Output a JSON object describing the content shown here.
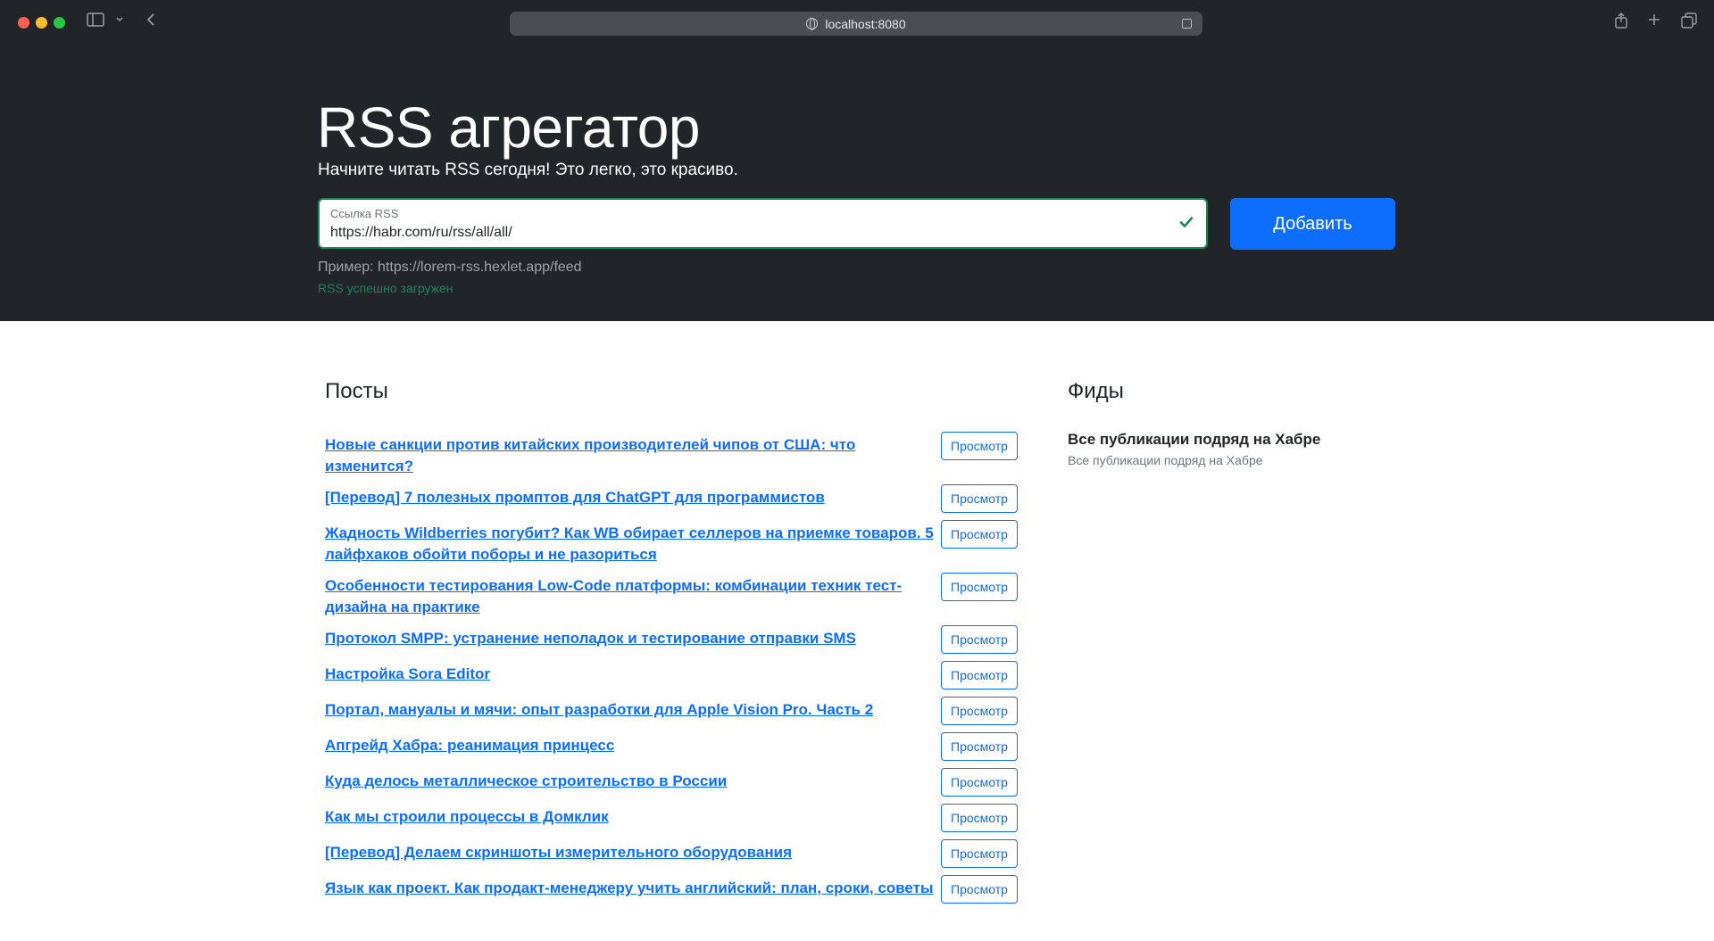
{
  "browser": {
    "url": "localhost:8080"
  },
  "hero": {
    "title": "RSS агрегатор",
    "lead": "Начните читать RSS сегодня! Это легко, это красиво.",
    "input_label": "Ссылка RSS",
    "input_value": "https://habr.com/ru/rss/all/all/",
    "add_button": "Добавить",
    "example": "Пример: https://lorem-rss.hexlet.app/feed",
    "feedback": "RSS успешно загружен"
  },
  "posts": {
    "title": "Посты",
    "view_label": "Просмотр",
    "items": [
      "Новые санкции против китайских производителей чипов от США: что изменится?",
      "[Перевод] 7 полезных промптов для ChatGPT для программистов",
      "Жадность Wildberries погубит? Как WB обирает селлеров на приемке товаров. 5 лайфхаков обойти поборы и не разориться",
      "Особенности тестирования Low-Code платформы: комбинации техник тест-дизайна на практике",
      "Протокол SMPP: устранение неполадок и тестирование отправки SMS",
      "Настройка Sora Editor",
      "Портал, мануалы и мячи: опыт разработки для Apple Vision Pro. Часть 2",
      "Апгрейд Хабра: реанимация принцесс",
      "Куда делось металлическое строительство в России",
      "Как мы строили процессы в Домклик",
      "[Перевод] Делаем скриншоты измерительного оборудования",
      "Язык как проект. Как продакт-менеджеру учить английский: план, сроки, советы"
    ]
  },
  "feeds": {
    "title": "Фиды",
    "items": [
      {
        "title": "Все публикации подряд на Хабре",
        "description": "Все публикации подряд на Хабре"
      }
    ]
  }
}
